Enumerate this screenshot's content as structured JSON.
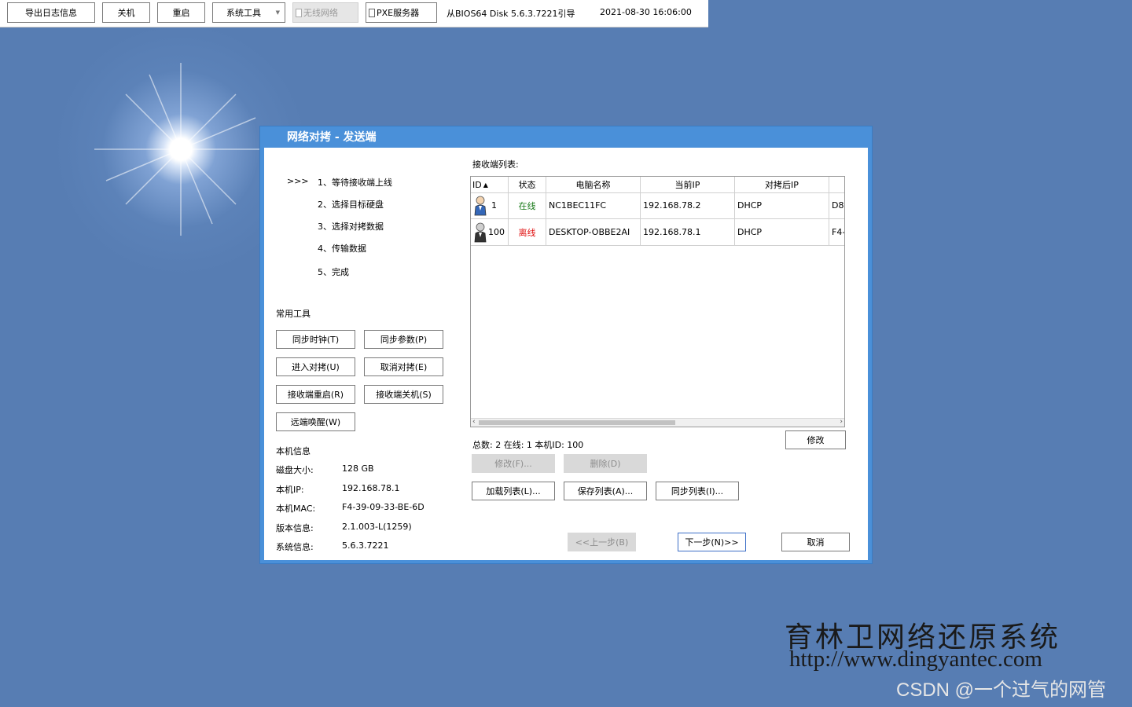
{
  "topbar": {
    "export_log": "导出日志信息",
    "shutdown": "关机",
    "restart": "重启",
    "system_tools": "系统工具",
    "wireless": "无线网络",
    "pxe_server": "PXE服务器",
    "boot_info": "从BIOS64 Disk 5.6.3.7221引导",
    "datetime": "2021-08-30 16:06:00"
  },
  "dialog": {
    "title": "网络对拷 - 发送端",
    "step_marker": ">>>",
    "steps": [
      "1、等待接收端上线",
      "2、选择目标硬盘",
      "3、选择对拷数据",
      "4、传输数据",
      "5、完成"
    ],
    "tools_title": "常用工具",
    "tools": {
      "sync_clock": "同步时钟(T)",
      "sync_params": "同步参数(P)",
      "enter_copy": "进入对拷(U)",
      "cancel_copy": "取消对拷(E)",
      "receiver_restart": "接收端重启(R)",
      "receiver_shutdown": "接收端关机(S)",
      "wake_remote": "远端唤醒(W)"
    },
    "local_info_title": "本机信息",
    "local_info": [
      {
        "label": "磁盘大小:",
        "value": "128 GB"
      },
      {
        "label": "本机IP:",
        "value": "192.168.78.1"
      },
      {
        "label": "本机MAC:",
        "value": "F4-39-09-33-BE-6D"
      },
      {
        "label": "版本信息:",
        "value": "2.1.003-L(1259)"
      },
      {
        "label": "系统信息:",
        "value": "5.6.3.7221"
      }
    ],
    "receiver_list_title": "接收端列表:",
    "table": {
      "columns": [
        "ID",
        "状态",
        "电脑名称",
        "当前IP",
        "对拷后IP",
        ""
      ],
      "rows": [
        {
          "id": "1",
          "status": "在线",
          "name": "NC1BEC11FC",
          "ip": "192.168.78.2",
          "after_ip": "DHCP",
          "extra": "D8-"
        },
        {
          "id": "100",
          "status": "离线",
          "name": "DESKTOP-OBBE2AI",
          "ip": "192.168.78.1",
          "after_ip": "DHCP",
          "extra": "F4-"
        }
      ]
    },
    "summary": "总数: 2 在线: 1 本机ID: 100",
    "modify": "修改",
    "edit": "修改(F)...",
    "delete": "删除(D)",
    "load_list": "加载列表(L)...",
    "save_list": "保存列表(A)...",
    "sync_list": "同步列表(I)...",
    "prev": "<<上一步(B)",
    "next": "下一步(N)>>",
    "cancel": "取消"
  },
  "watermark": {
    "title": "育林卫网络还原系统",
    "url": "http://www.dingyantec.com",
    "csdn": "CSDN @一个过气的网管"
  },
  "colors": {
    "desktop": "#577db3",
    "dialog_frame": "#4a90d9",
    "online": "#1a7a1a",
    "offline": "#e01010"
  }
}
